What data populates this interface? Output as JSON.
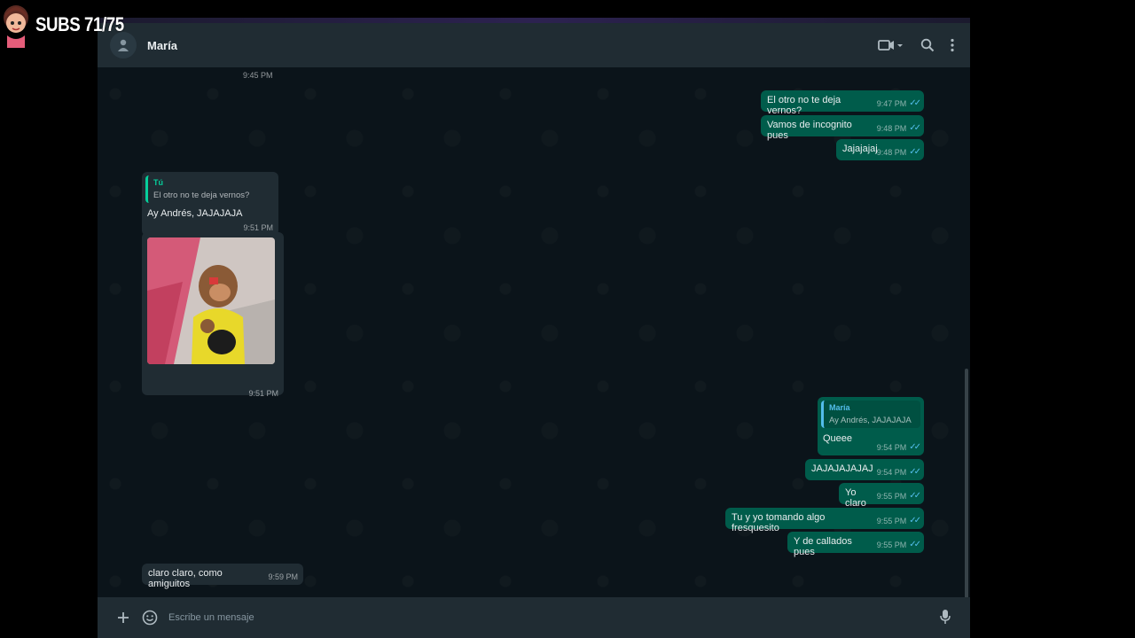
{
  "overlay": {
    "text": "SUBS 71/75"
  },
  "header": {
    "contact_name": "María"
  },
  "icons": {
    "avatar": "person-icon",
    "video": "video-call-icon",
    "search": "search-icon",
    "menu": "more-vert-icon",
    "attach": "plus-icon",
    "emoji": "emoji-icon",
    "mic": "mic-icon"
  },
  "colors": {
    "incoming_bubble": "#202c33",
    "outgoing_bubble": "#005c4b",
    "read_ticks": "#53bdeb",
    "quote_green": "#06cf9c",
    "quote_blue": "#53bdeb"
  },
  "messages": {
    "t0": {
      "time": "9:45 PM"
    },
    "m1": {
      "text": "El otro no te deja vernos?",
      "time": "9:47 PM"
    },
    "m2": {
      "text": "Vamos de incognito pues",
      "time": "9:48 PM"
    },
    "m3": {
      "text": "Jajajajaj",
      "time": "9:48 PM"
    },
    "m4": {
      "quote_name": "Tú",
      "quote_text": "El otro no te deja vernos?",
      "text": "Ay Andrés, JAJAJAJA",
      "time": "9:51 PM"
    },
    "m5": {
      "time": "9:51 PM"
    },
    "m6": {
      "quote_name": "María",
      "quote_text": "Ay Andrés, JAJAJAJA",
      "text": "Queee",
      "time": "9:54 PM"
    },
    "m7": {
      "text": "JAJAJAJAJAJ",
      "time": "9:54 PM"
    },
    "m8": {
      "text": "Yo claro",
      "time": "9:55 PM"
    },
    "m9": {
      "text": "Tu y yo tomando algo fresquesito",
      "time": "9:55 PM"
    },
    "m10": {
      "text": "Y de callados pues",
      "time": "9:55 PM"
    },
    "m11": {
      "text": "claro claro, como amiguitos",
      "time": "9:59 PM"
    }
  },
  "composer": {
    "placeholder": "Escribe un mensaje"
  }
}
